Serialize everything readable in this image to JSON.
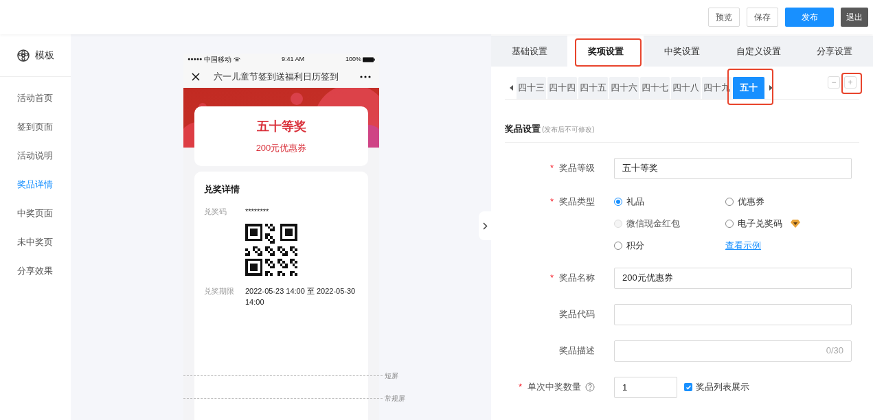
{
  "header": {
    "buttons": [
      {
        "label": "预览",
        "kind": "outline"
      },
      {
        "label": "保存",
        "kind": "outline"
      },
      {
        "label": "发布",
        "kind": "primary"
      },
      {
        "label": "退出",
        "kind": "dark"
      }
    ]
  },
  "sidebar": {
    "title": "模板",
    "items": [
      {
        "label": "活动首页",
        "selected": false
      },
      {
        "label": "签到页面",
        "selected": false
      },
      {
        "label": "活动说明",
        "selected": false
      },
      {
        "label": "奖品详情",
        "selected": true
      },
      {
        "label": "中奖页面",
        "selected": false
      },
      {
        "label": "未中奖页",
        "selected": false
      },
      {
        "label": "分享效果",
        "selected": false
      }
    ]
  },
  "preview": {
    "status_bar": {
      "signal": "●●●●●",
      "carrier": "中国移动",
      "time": "9:41 AM",
      "battery": "100%"
    },
    "nav_title": "六一儿童节签到送福利日历签到",
    "prize_card": {
      "level": "五十等奖",
      "name": "200元优惠券"
    },
    "details": {
      "title": "兑奖详情",
      "rows": [
        {
          "label": "兑奖码",
          "value": "********",
          "kind": "code"
        },
        {
          "label": "兑奖期限",
          "value": "2022-05-23 14:00 至 2022-05-30 14:00",
          "kind": "text"
        }
      ]
    },
    "guides": [
      {
        "label": "短屏"
      },
      {
        "label": "常规屏"
      }
    ]
  },
  "panel": {
    "tabs": [
      {
        "label": "基础设置",
        "selected": false,
        "annotated": false
      },
      {
        "label": "奖项设置",
        "selected": true,
        "annotated": true
      },
      {
        "label": "中奖设置",
        "selected": false,
        "annotated": false
      },
      {
        "label": "自定义设置",
        "selected": false,
        "annotated": false
      },
      {
        "label": "分享设置",
        "selected": false,
        "annotated": false
      }
    ],
    "level_tabs": [
      {
        "label": "四十三",
        "selected": false,
        "annotated": false
      },
      {
        "label": "四十四",
        "selected": false,
        "annotated": false
      },
      {
        "label": "四十五",
        "selected": false,
        "annotated": false
      },
      {
        "label": "四十六",
        "selected": false,
        "annotated": false
      },
      {
        "label": "四十七",
        "selected": false,
        "annotated": false
      },
      {
        "label": "四十八",
        "selected": false,
        "annotated": false
      },
      {
        "label": "四十九",
        "selected": false,
        "annotated": false
      },
      {
        "label": "五十",
        "selected": true,
        "annotated": true
      }
    ],
    "level_buttons": [
      {
        "label": "−",
        "annotated": false
      },
      {
        "label": "+",
        "annotated": true
      }
    ],
    "section": {
      "title": "奖品设置",
      "note": "(发布后不可修改)"
    },
    "fields": [
      {
        "kind": "text",
        "label": "奖品等级",
        "mark": "*",
        "value": "五十等奖"
      },
      {
        "kind": "radio",
        "label": "奖品类型",
        "mark": "*",
        "link": "查看示例",
        "options": [
          {
            "label": "礼品",
            "selected": true,
            "disabled": false,
            "premium": false
          },
          {
            "label": "优惠券",
            "selected": false,
            "disabled": false,
            "premium": false
          },
          {
            "label": "微信现金红包",
            "selected": false,
            "disabled": true,
            "premium": false
          },
          {
            "label": "电子兑奖码",
            "selected": false,
            "disabled": false,
            "premium": true
          },
          {
            "label": "积分",
            "selected": false,
            "disabled": false,
            "premium": false
          }
        ]
      },
      {
        "kind": "text",
        "label": "奖品名称",
        "mark": "*",
        "value": "200元优惠券"
      },
      {
        "kind": "text",
        "label": "奖品代码"
      },
      {
        "kind": "counter",
        "label": "奖品描述",
        "counter": "0/30"
      },
      {
        "kind": "quantity",
        "label": "单次中奖数量",
        "mark": "*",
        "help": true,
        "value": "1",
        "checkbox": {
          "label": "奖品列表展示",
          "checked": true
        }
      }
    ]
  }
}
